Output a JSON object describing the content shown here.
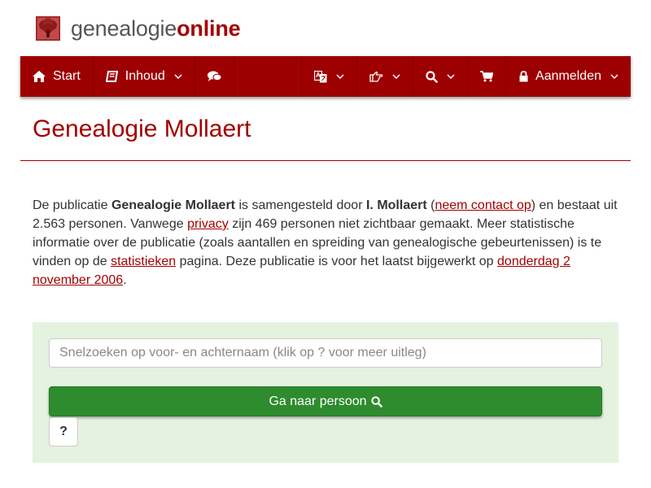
{
  "colors": {
    "brand": "#9c0000",
    "accent_text": "#a30000",
    "button_green": "#2e8b2e",
    "panel_bg": "#e5f2e0"
  },
  "logo": {
    "part1": "genealogie",
    "part2": "online",
    "icon": "tree-icon"
  },
  "nav": {
    "start_label": "Start",
    "start_icon": "home-icon",
    "inhoud_label": "Inhoud",
    "inhoud_icon": "book-icon",
    "comments_icon": "comments-icon",
    "language_icon": "language-icon",
    "hand_icon": "hand-pointing-icon",
    "search_icon": "search-icon",
    "cart_icon": "cart-icon",
    "login_label": "Aanmelden",
    "login_icon": "lock-icon"
  },
  "page": {
    "title": "Genealogie Mollaert"
  },
  "intro": {
    "t1": "De publicatie ",
    "pub_name": "Genealogie Mollaert",
    "t2": " is samengesteld door ",
    "author": "I. Mollaert",
    "t3": " (",
    "contact_link": "neem contact op",
    "t4": ") en bestaat uit 2.563 personen. Vanwege ",
    "privacy_link": "privacy",
    "t5": " zijn 469 personen niet zichtbaar gemaakt. Meer statistische informatie over de publicatie (zoals aantallen en spreiding van genealogische gebeurtenissen) is te vinden op de ",
    "stats_link": "statistieken",
    "t6": " pagina. Deze publicatie is voor het laatst bijgewerkt op ",
    "date_link": "donderdag 2 november 2006",
    "t7": "."
  },
  "search": {
    "placeholder": "Snelzoeken op voor- en achternaam (klik op ? voor meer uitleg)",
    "value": "",
    "go_label": "Ga naar persoon",
    "help_label": "?"
  }
}
